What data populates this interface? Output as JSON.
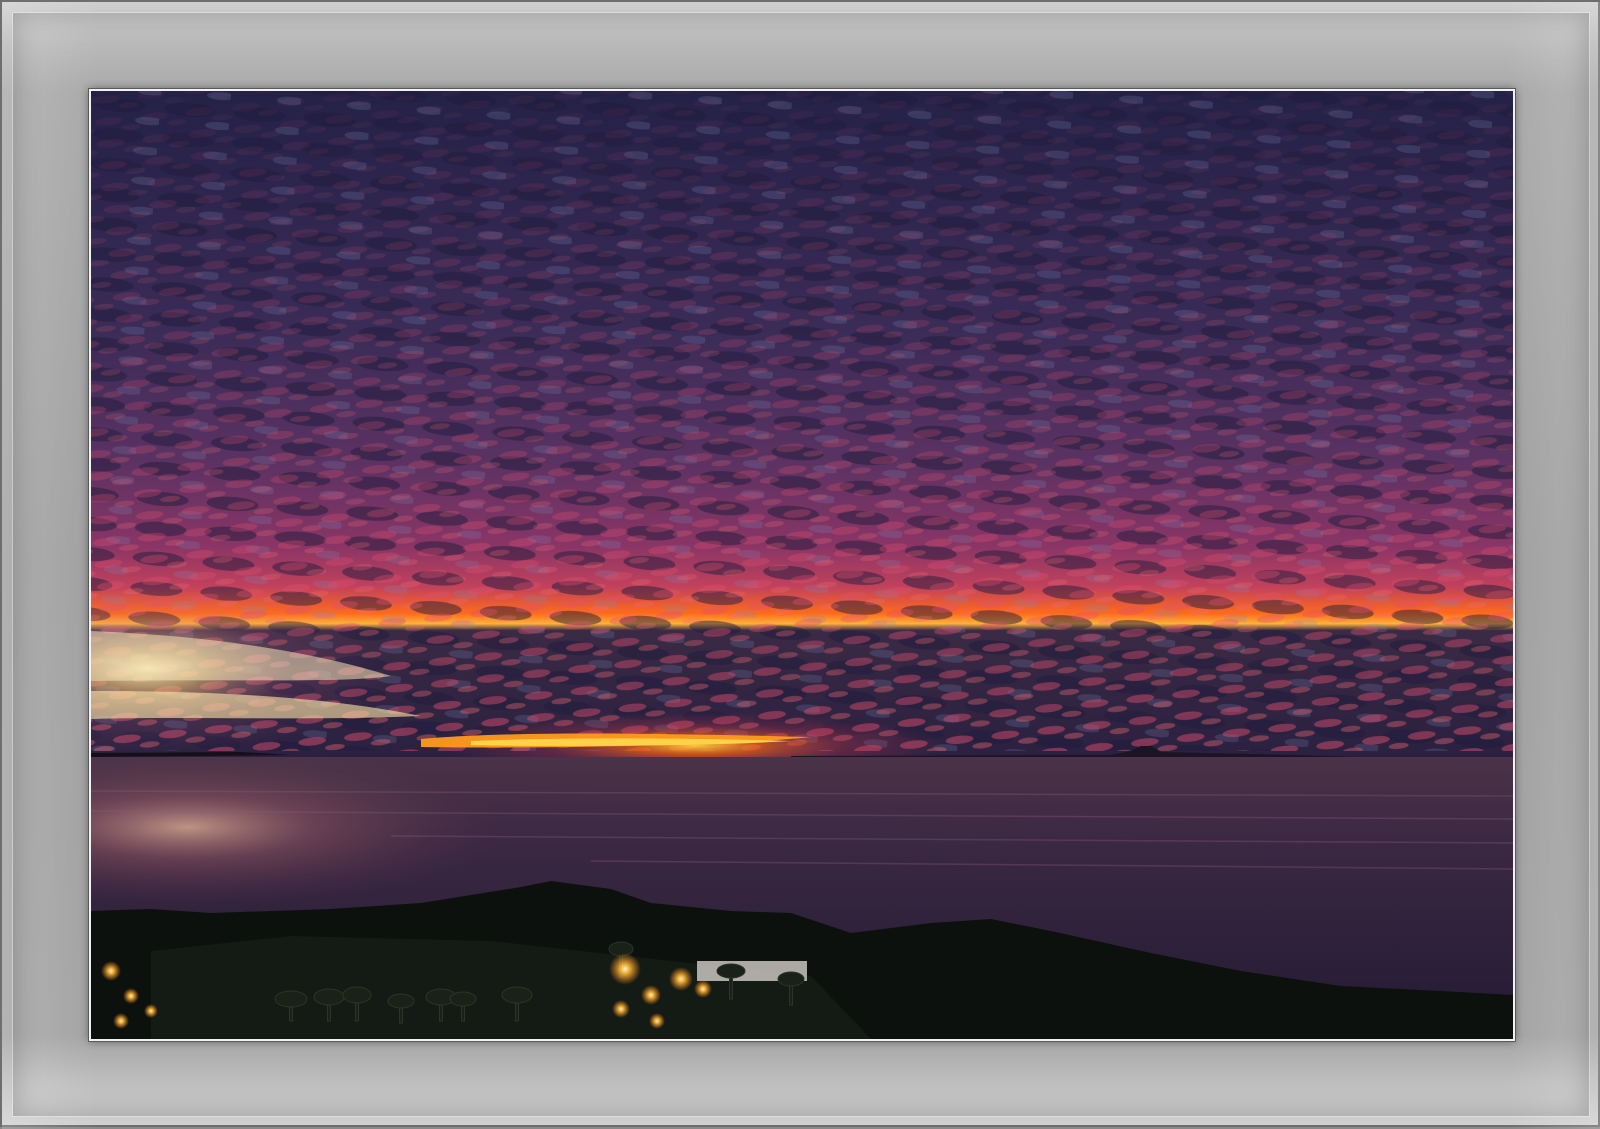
{
  "image": {
    "subject": "sunset-over-sea",
    "colors": {
      "frame": "#a6a6a6",
      "mat_border": "#f2f2f2",
      "sky_top": "#28234a",
      "sky_mid": "#4a2f5e",
      "cloud_pink": "#d8466a",
      "horizon_orange": "#ff7a10",
      "horizon_yellow": "#ffd34a",
      "sea": "#2e2240",
      "land": "#0f120f",
      "lights": "#ffb93a"
    }
  }
}
